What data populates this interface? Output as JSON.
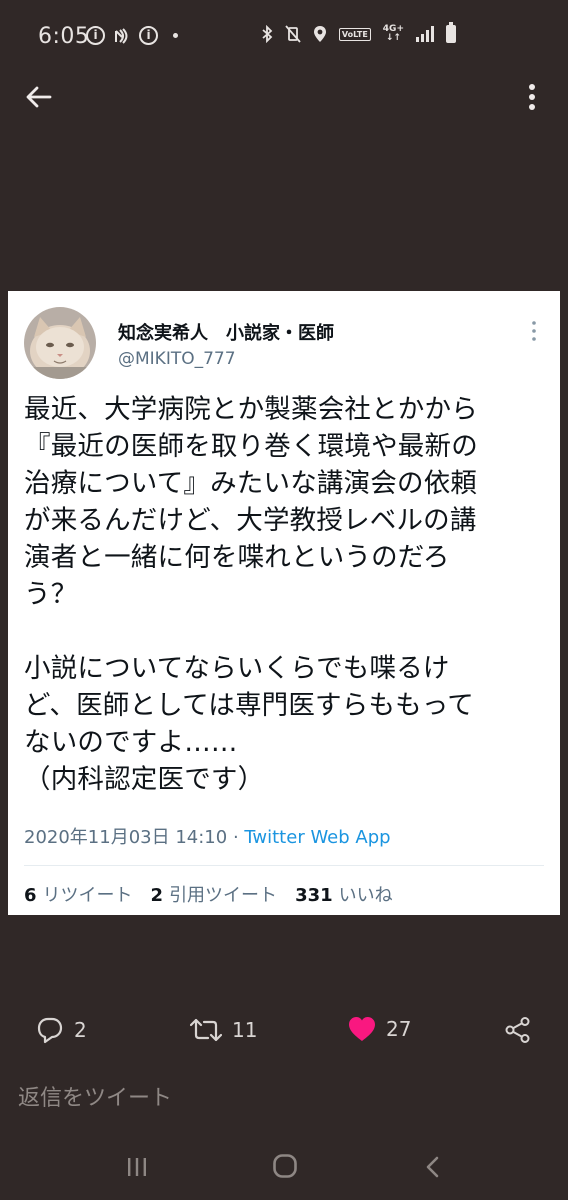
{
  "status_bar": {
    "time": "6:05",
    "volte": "VoLTE",
    "network_top": "4G+",
    "network_bottom": "↓↑"
  },
  "nav": {
    "back_icon": "arrow-left-icon",
    "more_icon": "more-vertical-icon"
  },
  "tweet": {
    "display_name": "知念実希人　小説家・医師",
    "handle": "@MIKITO_777",
    "text": "最近、大学病院とか製薬会社とかから\n『最近の医師を取り巻く環境や最新の\n治療について』みたいな講演会の依頼\nが来るんだけど、大学教授レベルの講\n演者と一緒に何を喋れというのだろ\nう？\n\n小説についてならいくらでも喋るけ\nど、医師としては専門医すらももって\nないのですよ……\n（内科認定医です）",
    "timestamp": "2020年11月03日 14:10",
    "separator": " · ",
    "source": "Twitter Web App",
    "retweets_count": "6",
    "retweets_label": "リツイート",
    "quotes_count": "2",
    "quotes_label": "引用ツイート",
    "likes_count": "331",
    "likes_label": "いいね"
  },
  "actions": {
    "reply_count": "2",
    "retweet_count": "11",
    "like_count": "27",
    "like_color": "#f91880"
  },
  "reply_placeholder": "返信をツイート"
}
